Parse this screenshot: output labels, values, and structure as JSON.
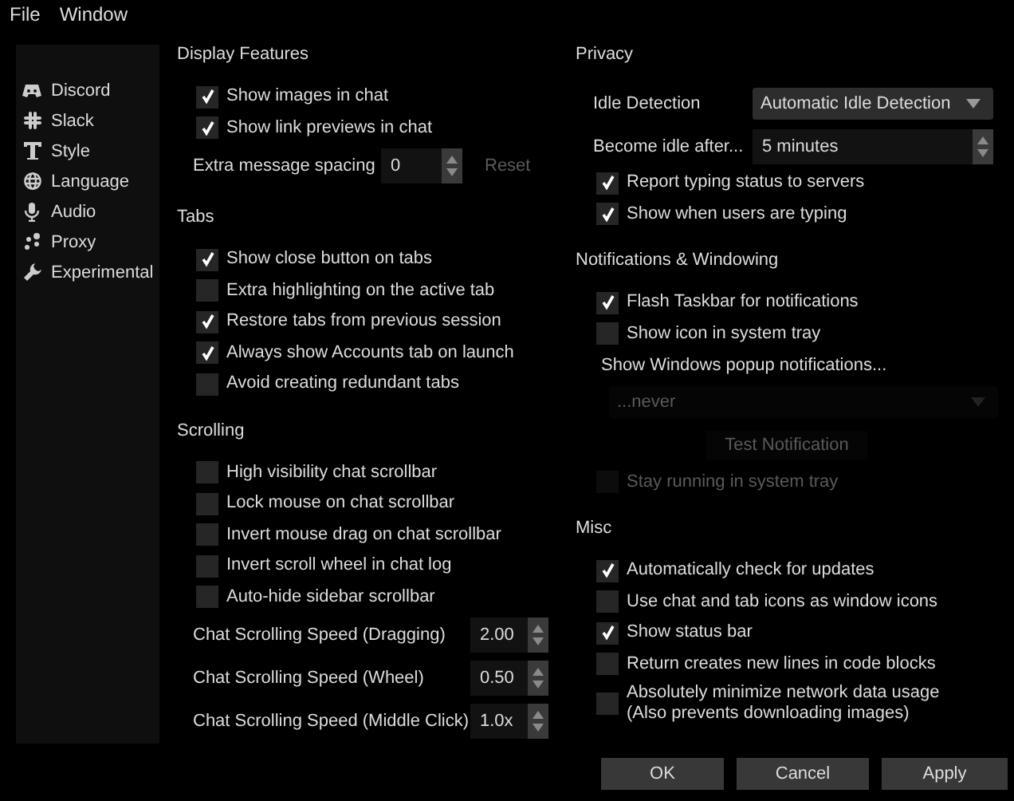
{
  "menu_bar": [
    {
      "label": "File"
    },
    {
      "label": "Window"
    }
  ],
  "sidebar": {
    "items": [
      {
        "label": "Discord"
      },
      {
        "label": "Slack"
      },
      {
        "label": "Style"
      },
      {
        "label": "Language"
      },
      {
        "label": "Audio"
      },
      {
        "label": "Proxy"
      },
      {
        "label": "Experimental"
      }
    ]
  },
  "columns": [
    {
      "sections": [
        {
          "title": "Display Features",
          "items": [
            {
              "kind": "checkbox",
              "label": "Show images in chat",
              "checked": true,
              "disabled": false
            },
            {
              "kind": "checkbox",
              "label": "Show link previews in chat",
              "checked": true,
              "disabled": false
            },
            {
              "kind": "spin",
              "label": "Extra message spacing",
              "value": "0",
              "reset": {
                "label": "Reset",
                "disabled": true
              }
            }
          ]
        },
        {
          "title": "Tabs",
          "items": [
            {
              "kind": "checkbox",
              "label": "Show close button on tabs",
              "checked": true,
              "disabled": false
            },
            {
              "kind": "checkbox",
              "label": "Extra highlighting on the active tab",
              "checked": false,
              "disabled": false
            },
            {
              "kind": "checkbox",
              "label": "Restore tabs from previous session",
              "checked": true,
              "disabled": false
            },
            {
              "kind": "checkbox",
              "label": "Always show Accounts tab on launch",
              "checked": true,
              "disabled": false
            },
            {
              "kind": "checkbox",
              "label": "Avoid creating redundant tabs",
              "checked": false,
              "disabled": false
            }
          ]
        },
        {
          "title": "Scrolling",
          "items": [
            {
              "kind": "checkbox",
              "label": "High visibility chat scrollbar",
              "checked": false,
              "disabled": false
            },
            {
              "kind": "checkbox",
              "label": "Lock mouse on chat scrollbar",
              "checked": false,
              "disabled": false
            },
            {
              "kind": "checkbox",
              "label": "Invert mouse drag on chat scrollbar",
              "checked": false,
              "disabled": false
            },
            {
              "kind": "checkbox",
              "label": "Invert scroll wheel in chat log",
              "checked": false,
              "disabled": false
            },
            {
              "kind": "checkbox",
              "label": "Auto-hide sidebar scrollbar",
              "checked": false,
              "disabled": false
            },
            {
              "kind": "spin",
              "label": "Chat Scrolling Speed (Dragging)",
              "value": "2.00"
            },
            {
              "kind": "spin",
              "label": "Chat Scrolling Speed (Wheel)",
              "value": "0.50"
            },
            {
              "kind": "spin",
              "label": "Chat Scrolling Speed (Middle Click)",
              "value": "1.0x"
            }
          ]
        }
      ]
    },
    {
      "sections": [
        {
          "title": "Privacy",
          "items": [
            {
              "kind": "combo",
              "label": "Idle Detection",
              "value": "Automatic Idle Detection",
              "disabled": false
            },
            {
              "kind": "spin",
              "label": "Become idle after...",
              "value": "5 minutes"
            },
            {
              "kind": "checkbox",
              "label": "Report typing status to servers",
              "checked": true,
              "disabled": false
            },
            {
              "kind": "checkbox",
              "label": "Show when users are typing",
              "checked": true,
              "disabled": false
            }
          ]
        },
        {
          "title": "Notifications & Windowing",
          "items": [
            {
              "kind": "checkbox",
              "label": "Flash Taskbar for notifications",
              "checked": true,
              "disabled": false
            },
            {
              "kind": "checkbox",
              "label": "Show icon in system tray",
              "checked": false,
              "disabled": false
            },
            {
              "kind": "label",
              "label": "Show Windows popup notifications..."
            },
            {
              "kind": "combo",
              "value": "...never",
              "disabled": true
            },
            {
              "kind": "button",
              "label": "Test Notification",
              "disabled": true
            },
            {
              "kind": "checkbox",
              "label": "Stay running in system tray",
              "checked": false,
              "disabled": true
            }
          ]
        },
        {
          "title": "Misc",
          "items": [
            {
              "kind": "checkbox",
              "label": "Automatically check for updates",
              "checked": true,
              "disabled": false
            },
            {
              "kind": "checkbox",
              "label": "Use chat and tab icons as window icons",
              "checked": false,
              "disabled": false
            },
            {
              "kind": "checkbox",
              "label": "Show status bar",
              "checked": true,
              "disabled": false
            },
            {
              "kind": "checkbox",
              "label": "Return creates new lines in code blocks",
              "checked": false,
              "disabled": false
            },
            {
              "kind": "checkbox",
              "label": "Absolutely minimize network data usage\n(Also prevents downloading images)",
              "checked": false,
              "disabled": false
            }
          ]
        }
      ]
    }
  ],
  "buttons": [
    {
      "label": "OK"
    },
    {
      "label": "Cancel"
    },
    {
      "label": "Apply"
    }
  ]
}
